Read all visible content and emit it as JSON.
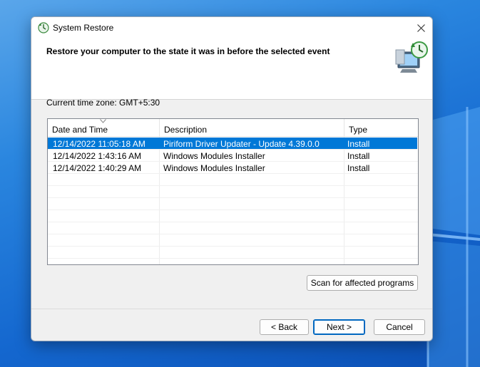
{
  "window": {
    "title": "System Restore",
    "icon": "system-restore-icon",
    "close_icon": "close-icon"
  },
  "header": {
    "heading": "Restore your computer to the state it was in before the selected event",
    "art_icon": "restore-monitor-clock-icon"
  },
  "timezone": {
    "label": "Current time zone: GMT+5:30"
  },
  "list": {
    "columns": [
      "Date and Time",
      "Description",
      "Type"
    ],
    "sort_column": "Date and Time",
    "sort_direction": "descending",
    "rows": [
      {
        "date": "12/14/2022 11:05:18 AM",
        "description": "Piriform Driver Updater - Update 4.39.0.0",
        "type": "Install",
        "selected": true
      },
      {
        "date": "12/14/2022 1:43:16 AM",
        "description": "Windows Modules Installer",
        "type": "Install",
        "selected": false
      },
      {
        "date": "12/14/2022 1:40:29 AM",
        "description": "Windows Modules Installer",
        "type": "Install",
        "selected": false
      }
    ]
  },
  "buttons": {
    "scan": "Scan for affected programs",
    "back": "< Back",
    "next": "Next >",
    "cancel": "Cancel"
  },
  "colors": {
    "selection": "#0078d7",
    "default_button_border": "#0067c0",
    "desktop": "#1467cf"
  }
}
